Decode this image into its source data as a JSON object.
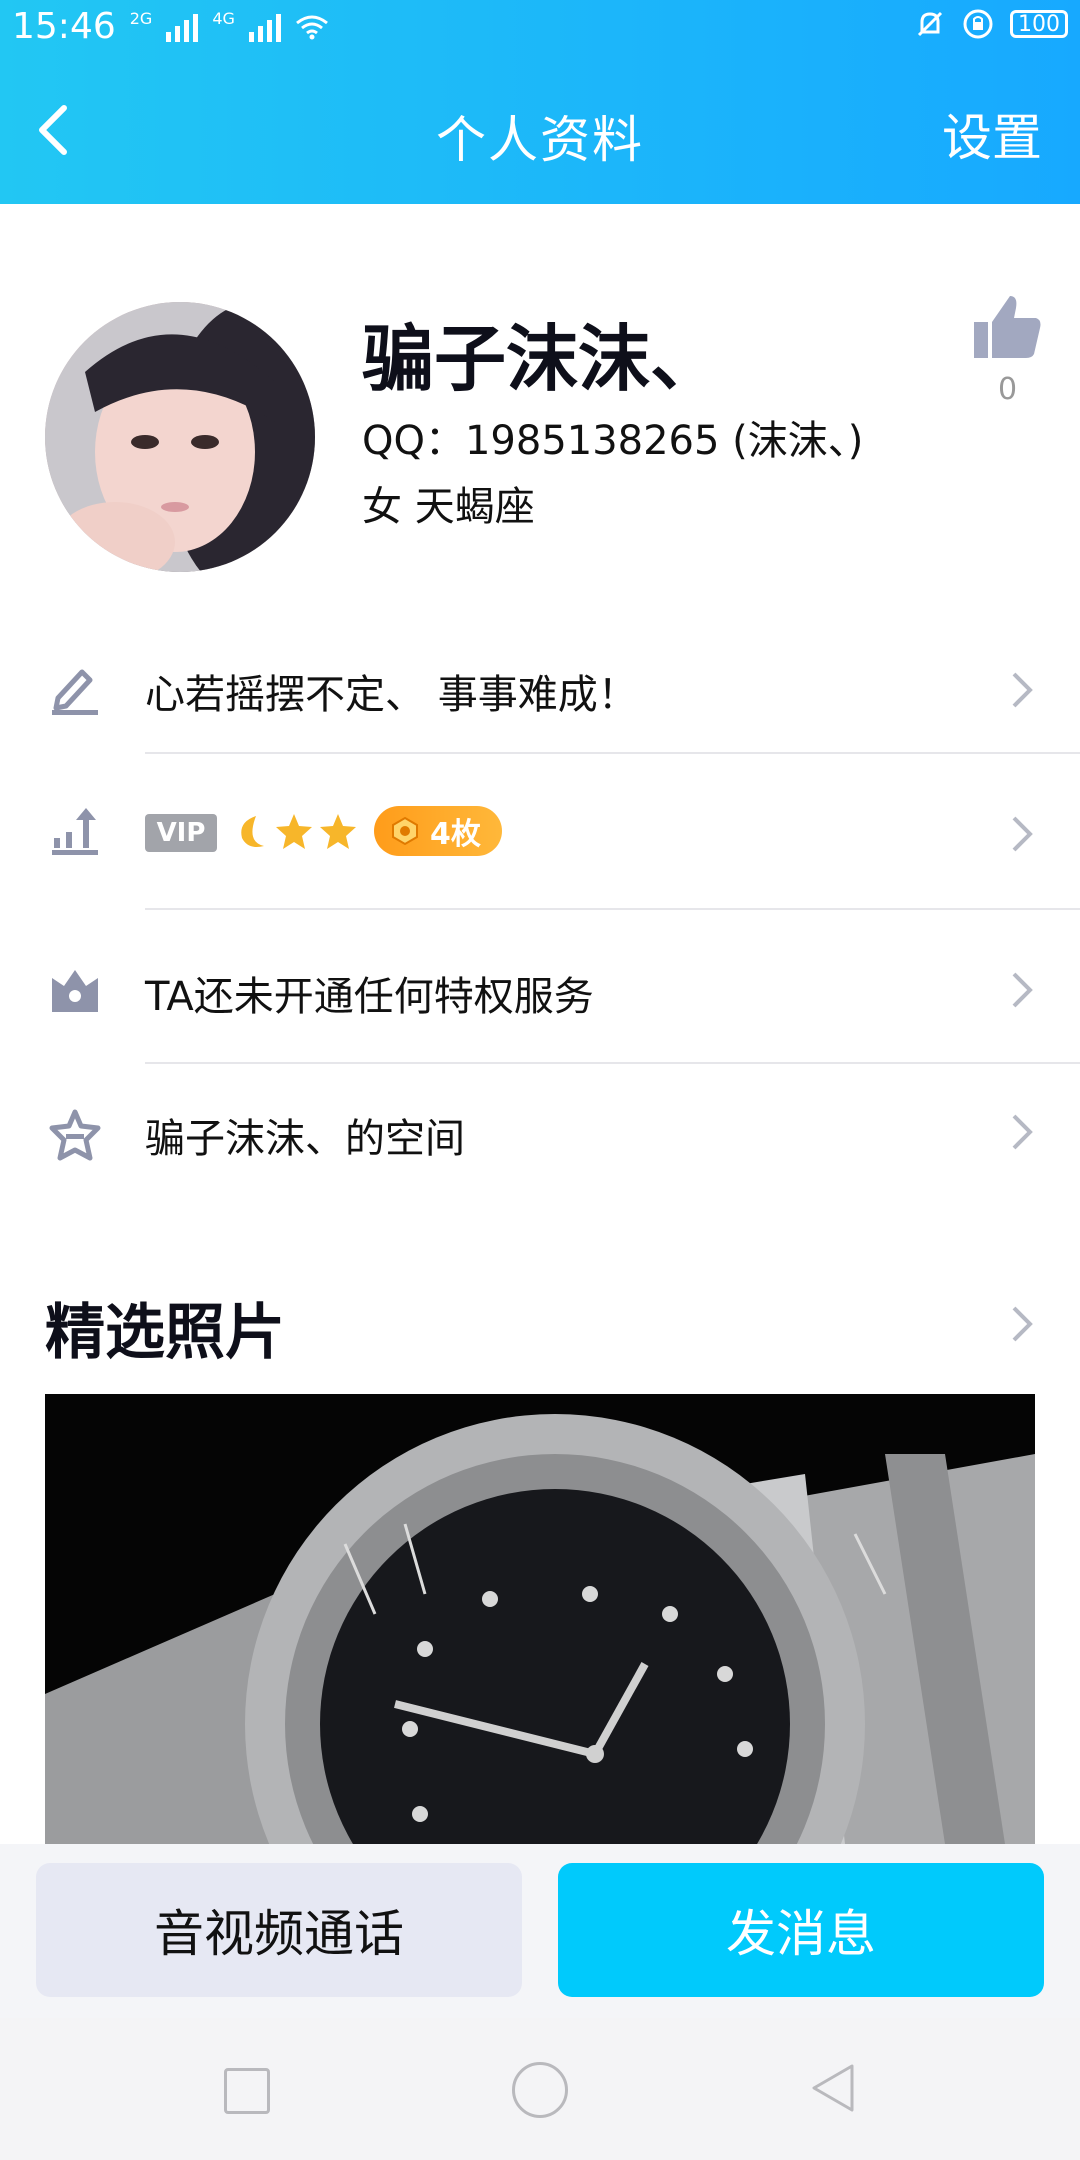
{
  "status_bar": {
    "time": "15:46",
    "net1": "2G",
    "net2": "4G",
    "battery": "100"
  },
  "header": {
    "title": "个人资料",
    "settings_label": "设置"
  },
  "profile": {
    "name": "骗子沫沫、",
    "qq": "QQ：1985138265 (沫沫、)",
    "gender_zodiac": "女  天蝎座",
    "like_count": "0"
  },
  "rows": {
    "signature": "心若摇摆不定、    事事难成！",
    "vip_tag": "VIP",
    "badge_count": "4枚",
    "privilege": "TA还未开通任何特权服务",
    "space": "骗子沫沫、的空间"
  },
  "photos": {
    "section_title": "精选照片"
  },
  "actions": {
    "call_label": "音视频通话",
    "message_label": "发消息"
  },
  "colors": {
    "header_start": "#22c7f3",
    "header_end": "#17a9ff",
    "accent_button": "#00cafc",
    "badge": "#ff9c1a"
  }
}
